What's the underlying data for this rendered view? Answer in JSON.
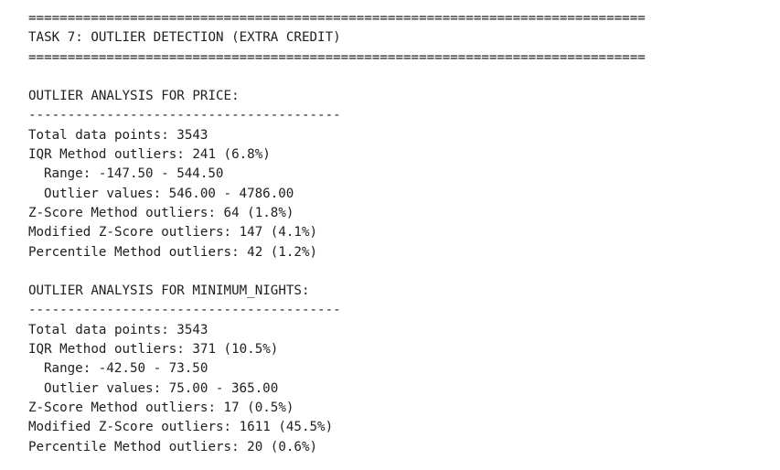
{
  "header": {
    "rule_top": "===============================================================================",
    "title": "TASK 7: OUTLIER DETECTION (EXTRA CREDIT)",
    "rule_bottom": "==============================================================================="
  },
  "sections": [
    {
      "heading": "OUTLIER ANALYSIS FOR PRICE:",
      "divider": "----------------------------------------",
      "total": "Total data points: 3543",
      "iqr": "IQR Method outliers: 241 (6.8%)",
      "range": "Range: -147.50 - 544.50",
      "outlier_values": "Outlier values: 546.00 - 4786.00",
      "zscore": "Z-Score Method outliers: 64 (1.8%)",
      "modified_zscore": "Modified Z-Score outliers: 147 (4.1%)",
      "percentile": "Percentile Method outliers: 42 (1.2%)"
    },
    {
      "heading": "OUTLIER ANALYSIS FOR MINIMUM_NIGHTS:",
      "divider": "----------------------------------------",
      "total": "Total data points: 3543",
      "iqr": "IQR Method outliers: 371 (10.5%)",
      "range": "Range: -42.50 - 73.50",
      "outlier_values": "Outlier values: 75.00 - 365.00",
      "zscore": "Z-Score Method outliers: 17 (0.5%)",
      "modified_zscore": "Modified Z-Score outliers: 1611 (45.5%)",
      "percentile": "Percentile Method outliers: 20 (0.6%)"
    }
  ]
}
